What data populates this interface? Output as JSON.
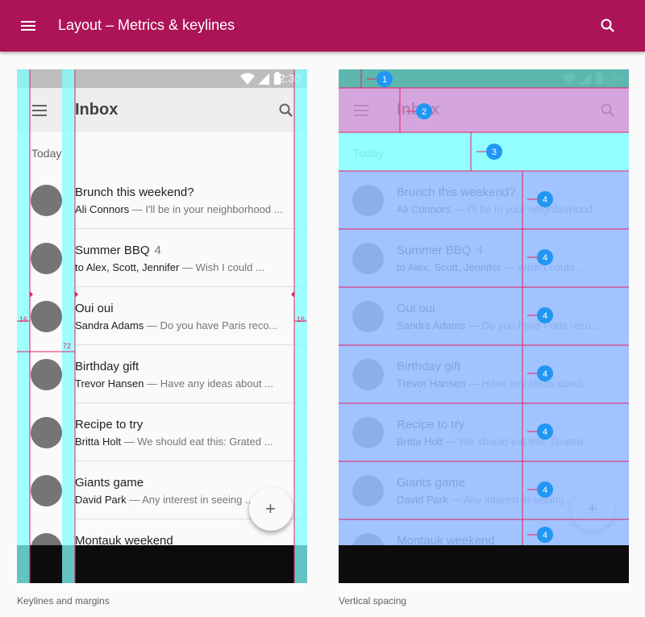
{
  "appbar": {
    "title": "Layout  –  Metrics & keylines",
    "color": "#ad1457"
  },
  "phone": {
    "status_time": "12:30",
    "toolbar_title": "Inbox",
    "subheader": "Today",
    "fab_label": "+",
    "emails": [
      {
        "title": "Brunch this weekend?",
        "count": "",
        "sender": "Ali Connors",
        "snippet": " — I'll be in your neighborhood ..."
      },
      {
        "title": "Summer BBQ",
        "count": "4",
        "sender": "to Alex, Scott, Jennifer",
        "snippet": " — Wish I could ..."
      },
      {
        "title": "Oui oui",
        "count": "",
        "sender": "Sandra Adams",
        "snippet": " — Do you have Paris reco..."
      },
      {
        "title": "Birthday gift",
        "count": "",
        "sender": "Trevor Hansen",
        "snippet": " — Have any ideas about ..."
      },
      {
        "title": "Recipe to try",
        "count": "",
        "sender": "Britta Holt",
        "snippet": " — We should eat this: Grated ..."
      },
      {
        "title": "Giants game",
        "count": "",
        "sender": "David Park",
        "snippet": " — Any interest in seeing ..."
      },
      {
        "title": "Montauk weekend",
        "count": "",
        "sender": "",
        "snippet": ""
      }
    ]
  },
  "left_panel": {
    "caption": "Keylines and margins",
    "measure_left": "16",
    "measure_keyline": "72",
    "measure_right": "16"
  },
  "right_panel": {
    "caption": "Vertical spacing",
    "markers": [
      "1",
      "2",
      "3",
      "4",
      "4",
      "4",
      "4",
      "4",
      "4",
      "4"
    ]
  },
  "colors": {
    "keyline_overlay": "#80ffff",
    "keyline_line": "#e91e63",
    "status_overlay": "#4db6ac",
    "toolbar_overlay": "#ce93d8",
    "subheader_overlay": "#80ffff",
    "row_overlay": "#90b8ff",
    "marker": "#2196f3"
  }
}
